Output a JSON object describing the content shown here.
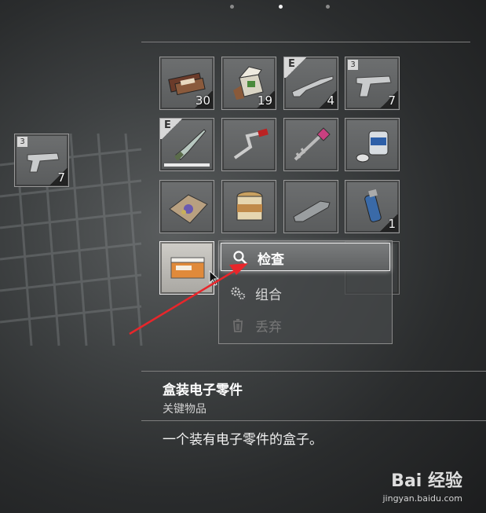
{
  "pager": {
    "dots": 3,
    "active_index": 1
  },
  "side_slot": {
    "box_count": "3",
    "quantity": "7",
    "icon": "handgun-icon"
  },
  "grid": [
    {
      "icon": "chocolate-bars-icon",
      "quantity": "30"
    },
    {
      "icon": "herb-box-icon",
      "quantity": "19"
    },
    {
      "icon": "shotgun-icon",
      "equipped_tag": "E",
      "quantity": "4"
    },
    {
      "icon": "handgun-icon",
      "box_count": "3",
      "quantity": "7"
    },
    {
      "icon": "knife-icon",
      "equipped_tag": "E",
      "durability": 1.0
    },
    {
      "icon": "crank-handle-icon"
    },
    {
      "icon": "ornate-key-icon"
    },
    {
      "icon": "chemical-fluid-icon"
    },
    {
      "icon": "herb-pouch-icon"
    },
    {
      "icon": "jar-icon"
    },
    {
      "icon": "metal-part-icon"
    },
    {
      "icon": "grenade-icon",
      "quantity": "1"
    },
    {
      "icon": "electronic-parts-box-icon",
      "selected": true
    }
  ],
  "context_menu": {
    "items": [
      {
        "label": "检查",
        "icon": "search-icon",
        "state": "active"
      },
      {
        "label": "组合",
        "icon": "gears-icon",
        "state": "normal"
      },
      {
        "label": "丢弃",
        "icon": "trash-icon",
        "state": "disabled"
      }
    ]
  },
  "item_info": {
    "name": "盒装电子零件",
    "category": "关键物品",
    "description": "一个装有电子零件的盒子。"
  },
  "watermark": {
    "logo": "Bai 经验",
    "url": "jingyan.baidu.com"
  },
  "colors": {
    "arrow": "#e8262b",
    "accent_active": "#ffffff"
  }
}
